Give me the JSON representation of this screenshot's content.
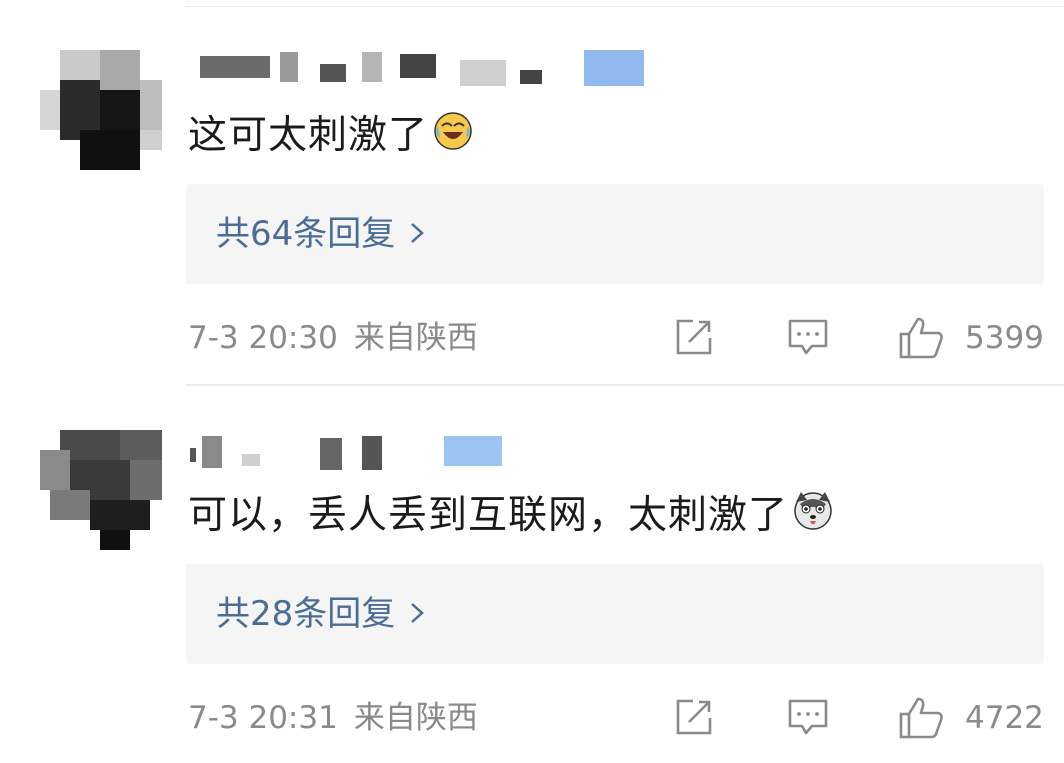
{
  "comments": [
    {
      "text": "这可太刺激了",
      "emoji": "crying-laughing-emoji",
      "reply_label": "共64条回复",
      "time": "7-3 20:30",
      "location": "来自陕西",
      "likes": "5399"
    },
    {
      "text": "可以，丢人丢到互联网，太刺激了",
      "emoji": "husky-dog-emoji",
      "reply_label": "共28条回复",
      "time": "7-3 20:31",
      "location": "来自陕西",
      "likes": "4722"
    }
  ],
  "icons": {
    "share": "share-icon",
    "comment": "comment-icon",
    "like": "thumbs-up-icon",
    "chevron": "chevron-right-icon"
  },
  "colors": {
    "reply_link": "#4a6c95",
    "meta_text": "#8a8a8a",
    "reply_bg": "#f5f5f5"
  }
}
